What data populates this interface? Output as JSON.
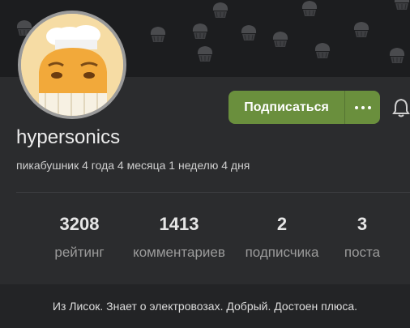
{
  "profile": {
    "username": "hypersonics",
    "tenure": "пикабушник 4 года 4 месяца 1 неделю 4 дня",
    "avatar_icon": "chef-muffin-avatar",
    "subscribe_label": "Подписаться",
    "more_icon": "more-dots-icon",
    "bell_icon": "bell-icon",
    "accent_color": "#6a8f3d"
  },
  "stats": [
    {
      "value": "3208",
      "label": "рейтинг"
    },
    {
      "value": "1413",
      "label": "комментариев"
    },
    {
      "value": "2",
      "label": "подписчика"
    },
    {
      "value": "3",
      "label": "поста"
    }
  ],
  "bio": "Из Лисок. Знает о электровозах. Добрый. Достоен плюса."
}
